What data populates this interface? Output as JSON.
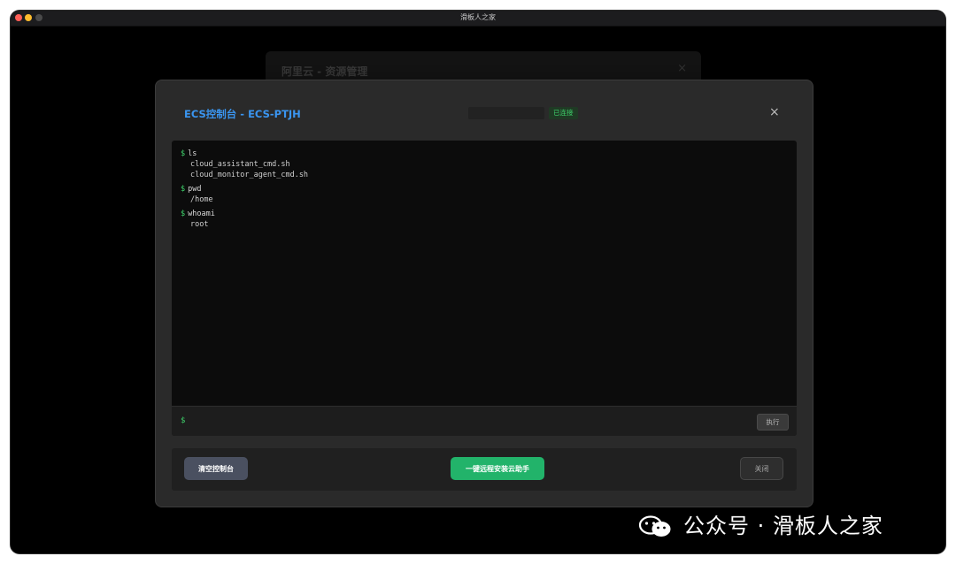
{
  "window": {
    "title": "滑板人之家"
  },
  "background": {
    "title": "阿里云 - 资源管理",
    "close_glyph": "×"
  },
  "modal": {
    "title": "ECS控制台 - ECS-PTJH",
    "status_badge": "已连接",
    "close_glyph": "×"
  },
  "terminal": {
    "prompt": "$",
    "history": [
      {
        "command": "ls",
        "output": [
          "cloud_assistant_cmd.sh",
          "cloud_monitor_agent_cmd.sh"
        ]
      },
      {
        "command": "pwd",
        "output": [
          "/home"
        ]
      },
      {
        "command": "whoami",
        "output": [
          "root"
        ]
      }
    ],
    "input_value": "",
    "exec_label": "执行"
  },
  "footer": {
    "clear_label": "清空控制台",
    "install_label": "一键远程安装云助手",
    "close_label": "关闭"
  },
  "watermark": {
    "text": "公众号 · 滑板人之家"
  },
  "colors": {
    "accent_blue": "#3a95f0",
    "prompt_green": "#3ecf6a",
    "install_green": "#22b36a",
    "clear_slate": "#4a5060"
  }
}
